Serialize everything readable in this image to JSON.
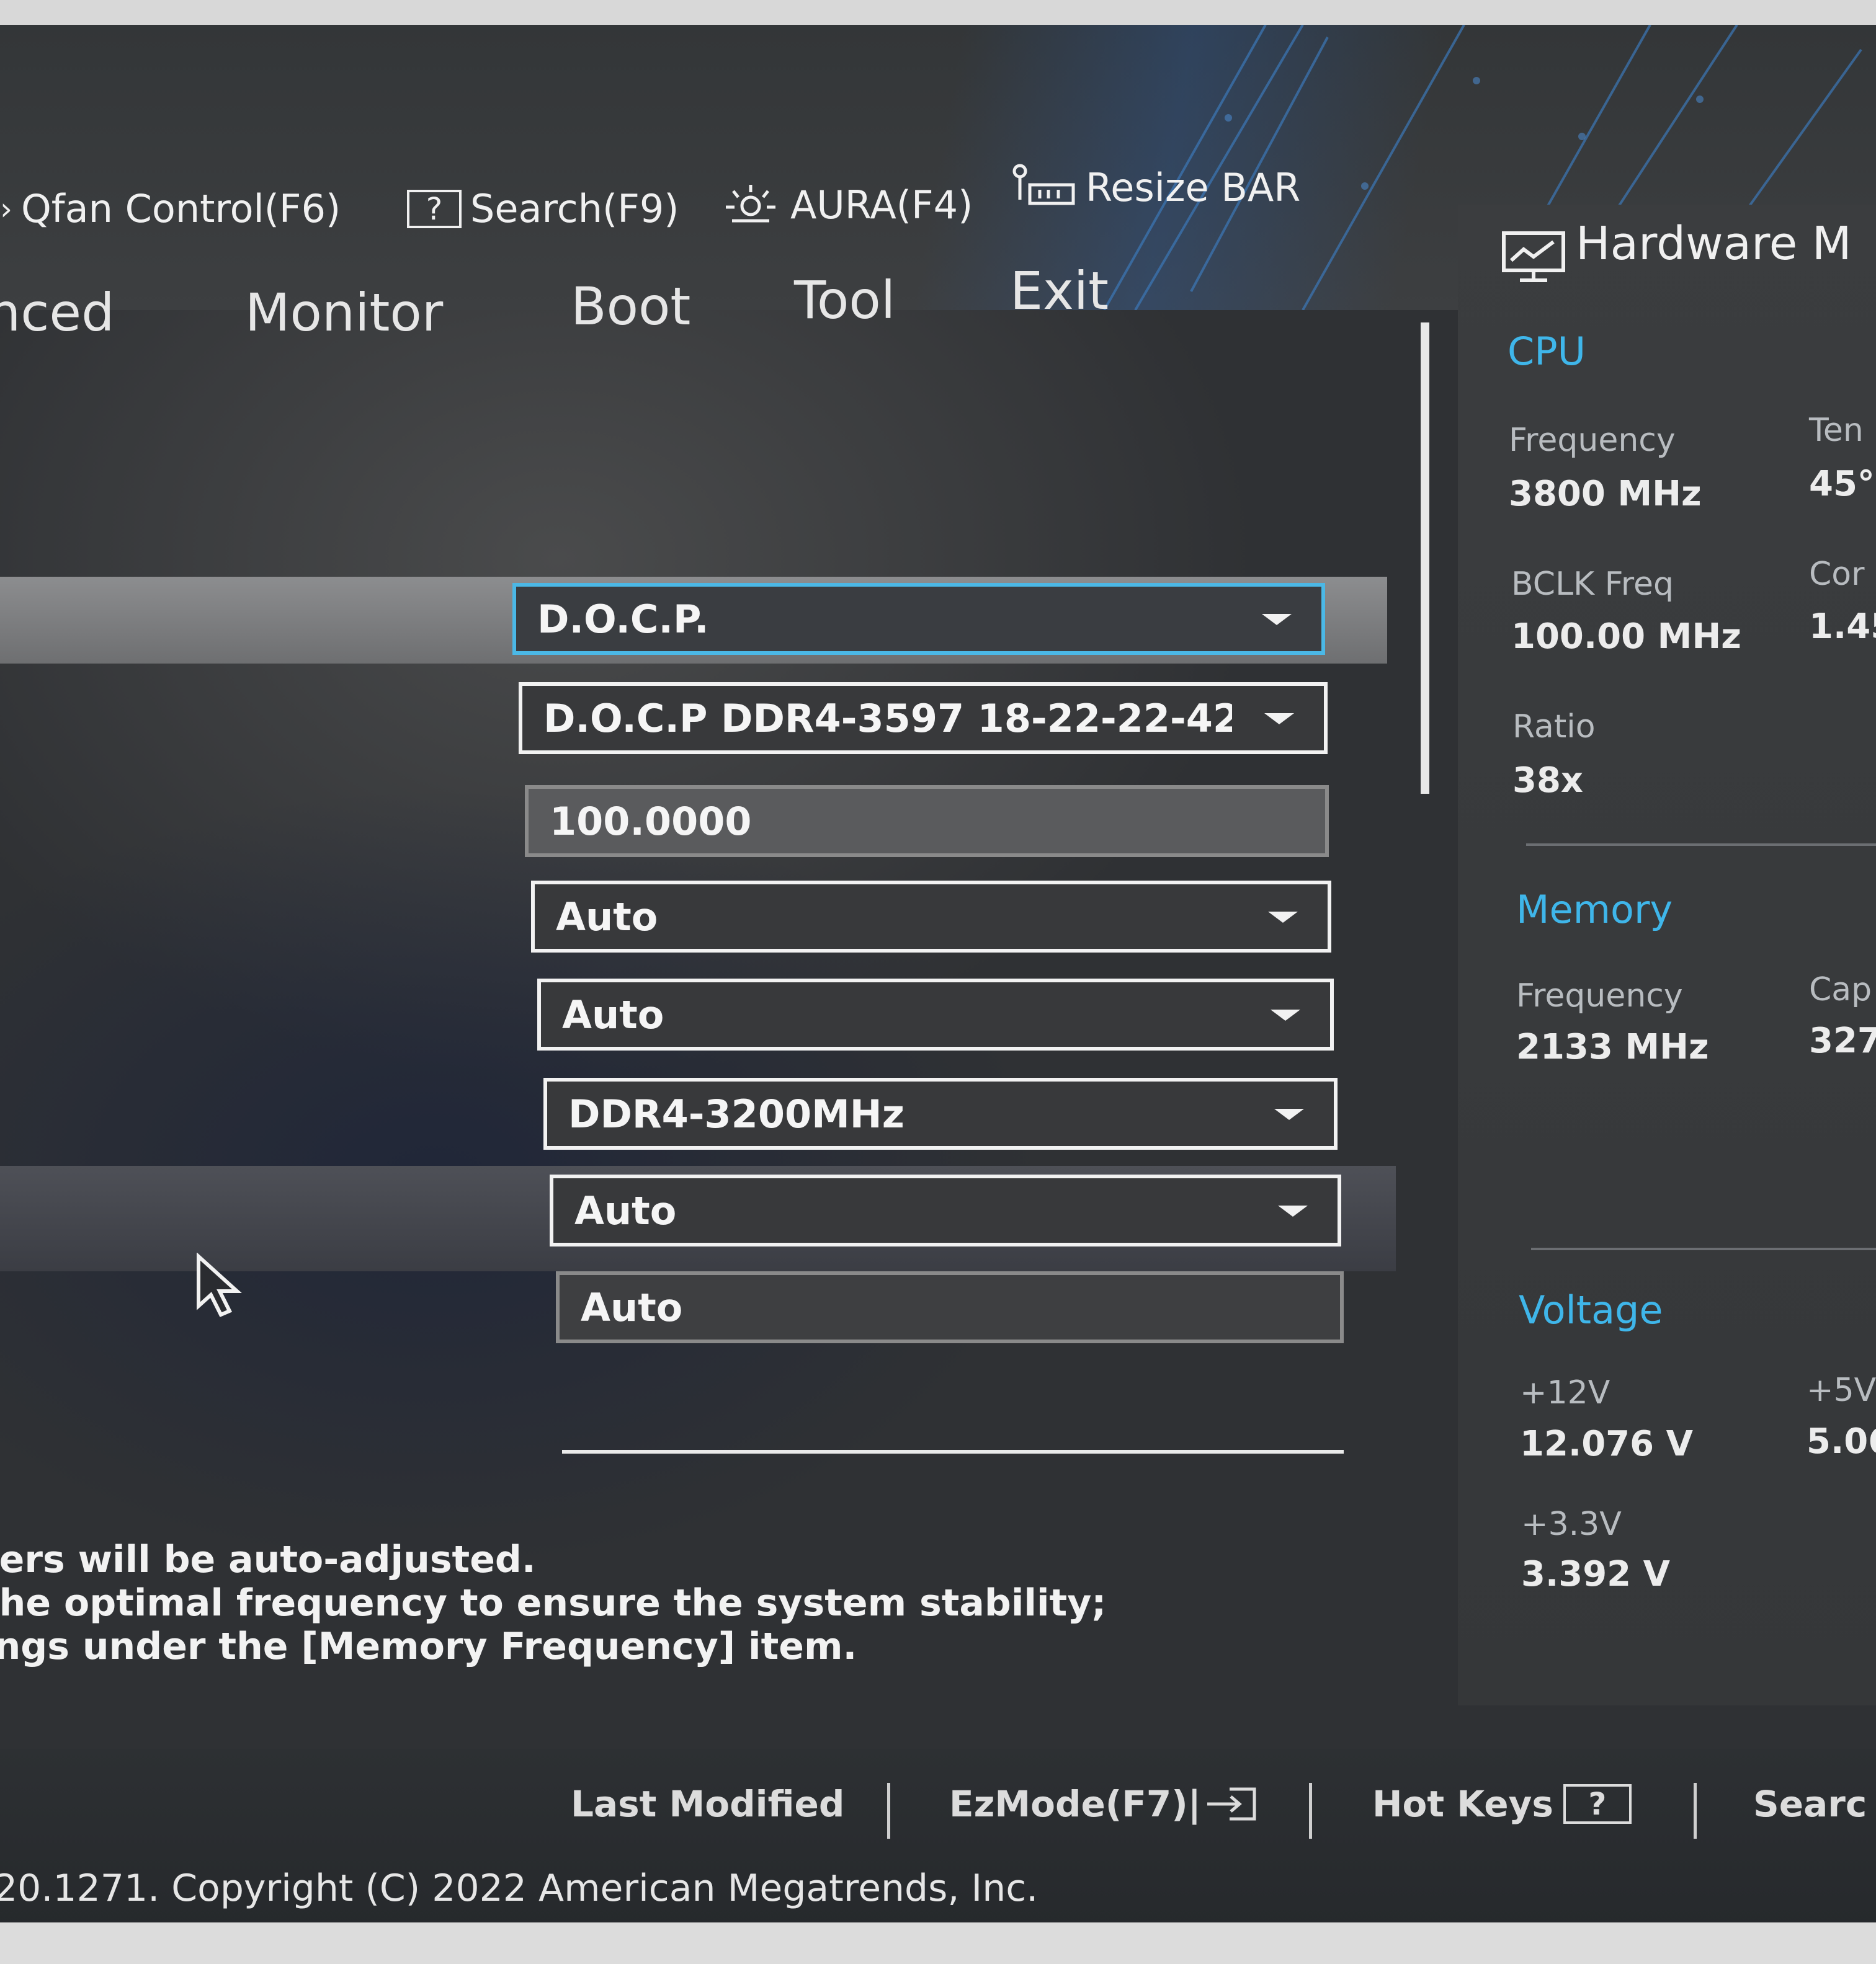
{
  "toolbar": {
    "qfan": "Qfan Control(F6)",
    "search": "Search(F9)",
    "aura": "AURA(F4)",
    "resize_bar": "Resize BAR",
    "search_icon_glyph": "?"
  },
  "tabs": [
    "nced",
    "Monitor",
    "Boot",
    "Tool",
    "Exit"
  ],
  "settings": {
    "fields": [
      {
        "value": "D.O.C.P.",
        "kind": "dropdown",
        "selected": true
      },
      {
        "value": "D.O.C.P DDR4-3597 18-22-22-42",
        "kind": "dropdown"
      },
      {
        "value": "100.0000",
        "kind": "readonly"
      },
      {
        "value": "Auto",
        "kind": "dropdown"
      },
      {
        "value": "Auto",
        "kind": "dropdown"
      },
      {
        "value": "DDR4-3200MHz",
        "kind": "dropdown"
      },
      {
        "value": "Auto",
        "kind": "dropdown"
      },
      {
        "value": "Auto",
        "kind": "readonly"
      }
    ]
  },
  "help": {
    "line1": "ters will be auto-adjusted.",
    "line2": " the optimal frequency to ensure the system stability;",
    "line3": "ings under the [Memory Frequency] item."
  },
  "hardware_monitor": {
    "title": "Hardware M",
    "cpu": {
      "heading": "CPU",
      "frequency_label": "Frequency",
      "frequency_value": "3800 MHz",
      "temp_label": "Ten",
      "temp_value": "45°",
      "bclk_label": "BCLK Freq",
      "bclk_value": "100.00 MHz",
      "core_label": "Cor",
      "core_value": "1.45",
      "ratio_label": "Ratio",
      "ratio_value": "38x"
    },
    "memory": {
      "heading": "Memory",
      "frequency_label": "Frequency",
      "frequency_value": "2133 MHz",
      "capacity_label": "Cap",
      "capacity_value": "327"
    },
    "voltage": {
      "heading": "Voltage",
      "v12_label": "+12V",
      "v12_value": "12.076 V",
      "v5_label": "+5V",
      "v5_value": "5.06",
      "v33_label": "+3.3V",
      "v33_value": "3.392 V"
    }
  },
  "footer": {
    "last_modified": "Last Modified",
    "ezmode": "EzMode(F7)|",
    "hot_keys": "Hot Keys",
    "hot_keys_glyph": "?",
    "search": "Searc",
    "copyright": "20.1271. Copyright (C) 2022 American Megatrends, Inc."
  },
  "colors": {
    "accent": "#3fb6ea",
    "selected_border": "#4bb8e6",
    "field_border": "#f2f2f2"
  },
  "icons": [
    "fan-icon",
    "search-help-icon",
    "aura-icon",
    "resize-bar-icon",
    "monitor-icon",
    "exit-arrow-icon",
    "hotkeys-help-icon",
    "dropdown-caret-icon",
    "mouse-cursor-icon"
  ]
}
